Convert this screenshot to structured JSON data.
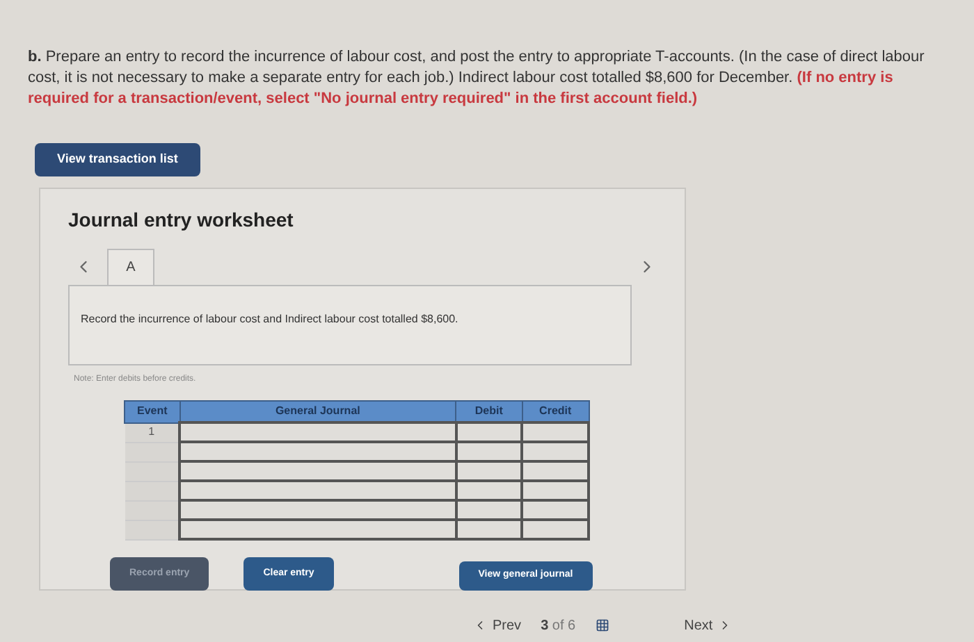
{
  "question": {
    "text": "**b.** Prepare an entry to record the incurrence of labour cost, and post the entry to appropriate T-accounts. (In the case of direct labour cost, it is not necessary to make a separate entry for each job.) Indirect labour cost totalled $8,600 for December.",
    "instruction": "(If no entry is required for a transaction/event, select \"No journal entry required\" in the first account field.)"
  },
  "transaction_button": "View transaction list",
  "worksheet": {
    "title": "Journal entry worksheet",
    "tabs": [
      {
        "label": "A",
        "selected": true
      }
    ],
    "description": "Record the incurrence of labour cost and Indirect labour cost totalled $8,600.",
    "note": "Note: Enter debits before credits.",
    "table": {
      "columns": [
        "Event",
        "General Journal",
        "Debit",
        "Credit"
      ],
      "rows": [
        {
          "event": "1"
        },
        {
          "event": ""
        },
        {
          "event": ""
        },
        {
          "event": ""
        },
        {
          "event": ""
        },
        {
          "event": ""
        }
      ]
    },
    "buttons": [
      {
        "label": "Record entry",
        "disabled": true
      },
      {
        "label": "Clear entry",
        "disabled": false
      },
      {
        "label": "View general journal",
        "disabled": false
      }
    ]
  },
  "pager": {
    "prev": "Prev",
    "current": "3",
    "of": "of 6",
    "next": "Next"
  }
}
